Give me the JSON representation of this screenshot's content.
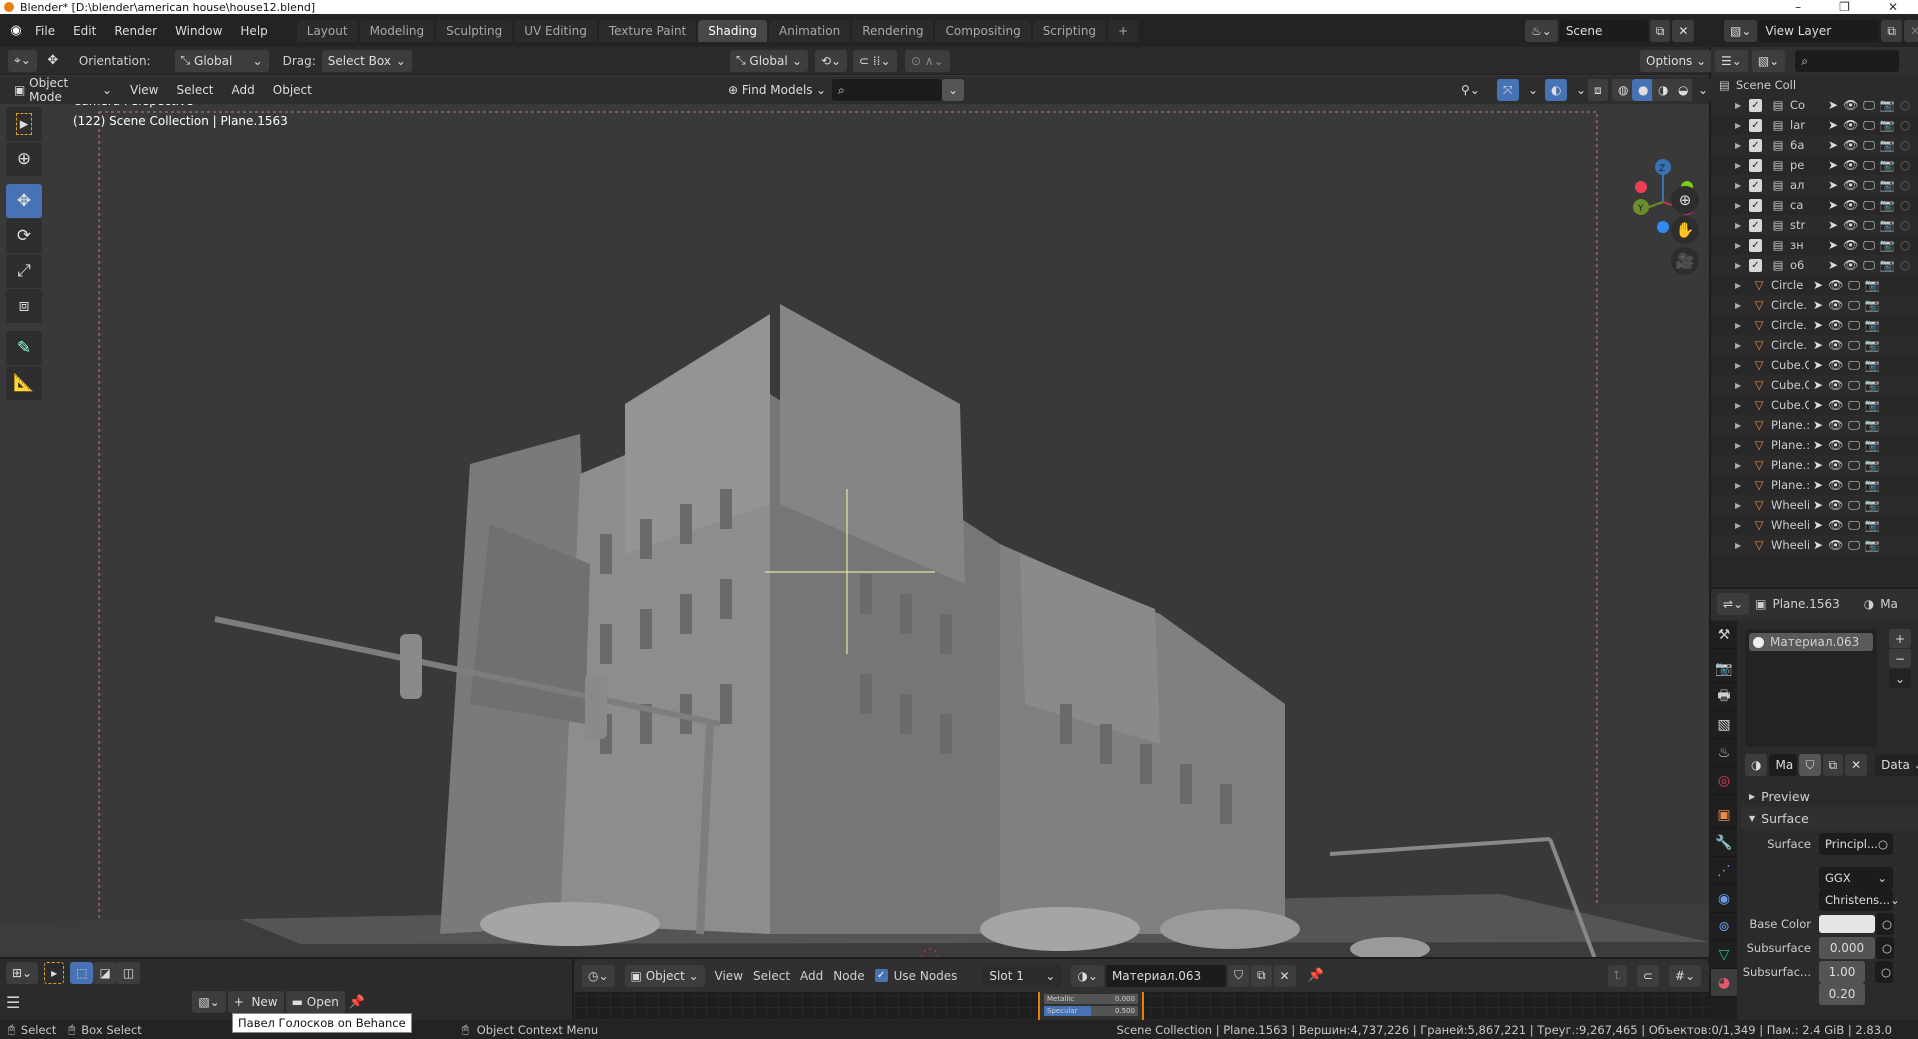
{
  "window": {
    "title": "Blender* [D:\\blender\\american house\\house12.blend]",
    "controls": [
      "–",
      "❐",
      "✕"
    ]
  },
  "menu": [
    "File",
    "Edit",
    "Render",
    "Window",
    "Help"
  ],
  "workspaces": [
    {
      "label": "Layout",
      "active": false
    },
    {
      "label": "Modeling",
      "active": false
    },
    {
      "label": "Sculpting",
      "active": false
    },
    {
      "label": "UV Editing",
      "active": false
    },
    {
      "label": "Texture Paint",
      "active": false
    },
    {
      "label": "Shading",
      "active": true
    },
    {
      "label": "Animation",
      "active": false
    },
    {
      "label": "Rendering",
      "active": false
    },
    {
      "label": "Compositing",
      "active": false
    },
    {
      "label": "Scripting",
      "active": false
    }
  ],
  "scene": {
    "name": "Scene",
    "view_layer": "View Layer"
  },
  "tool_header": {
    "orientation_label": "Orientation:",
    "orientation_value": "Global",
    "drag_label": "Drag:",
    "drag_value": "Select Box",
    "transform_orientation": "Global",
    "options_label": "Options"
  },
  "mode_header": {
    "mode": "Object Mode",
    "menus": [
      "View",
      "Select",
      "Add",
      "Object"
    ],
    "find_models": "Find Models",
    "search_placeholder": ""
  },
  "viewport": {
    "overlay_title": "Camera Perspective",
    "overlay_subtitle": "(122) Scene Collection | Plane.1563",
    "gizmo_axes": {
      "x": "X",
      "y": "Y",
      "z": "Z"
    },
    "colors": {
      "x": "#b33a4c",
      "y": "#6d8c2a",
      "z": "#3672b5",
      "accent": "#4772b3"
    }
  },
  "toolbar": [
    "select-box",
    "cursor",
    "move",
    "rotate",
    "scale",
    "transform",
    "annotate",
    "measure"
  ],
  "outliner": {
    "root": "Scene Coll",
    "collections": [
      "Co",
      "lar",
      "6a",
      "pe",
      "ал",
      "ca",
      "str",
      "зн",
      "o6"
    ],
    "objects": [
      "Circle",
      "Circle.",
      "Circle.",
      "Circle.",
      "Cube.C",
      "Cube.C",
      "Cube.C",
      "Plane.:",
      "Plane.:",
      "Plane.:",
      "Plane.:",
      "Wheeli",
      "Wheeli",
      "Wheeli"
    ]
  },
  "properties": {
    "object": "Plane.1563",
    "tab_label": "Ma",
    "material_slot": "Материал.063",
    "material_short": "Ma",
    "link": "Data",
    "panels": {
      "preview": "Preview",
      "surface": "Surface"
    },
    "surface_label": "Surface",
    "surface_value": "Principl...",
    "distribution": "GGX",
    "subsurface_method": "Christens...",
    "base_color_label": "Base Color",
    "base_color": "#e6e6e6",
    "subsurface_label": "Subsurface",
    "subsurface_value": "0.000",
    "subsurface_radius_label": "Subsurfac...",
    "subsurface_radius": [
      "1.00",
      "0.20"
    ]
  },
  "image_editor": {
    "new_label": "New",
    "open_label": "Open"
  },
  "node_editor": {
    "type": "Object",
    "menus": [
      "View",
      "Select",
      "Add",
      "Node"
    ],
    "use_nodes_label": "Use Nodes",
    "use_nodes": true,
    "slot": "Slot 1",
    "material": "Материал.063",
    "node_fields": [
      {
        "label": "Metallic",
        "value": "0.000"
      },
      {
        "label": "Specular",
        "value": "0.500"
      }
    ]
  },
  "tooltip": "Павел Голосков on Behance",
  "statusbar": {
    "select": "Select",
    "box_select": "Box Select",
    "context_menu": "Object Context Menu",
    "stats": "Scene Collection | Plane.1563 | Вершин:4,737,226 | Граней:5,867,221 | Треуг.:9,267,465 | Объектов:0/1,349 | Пам.: 2.4 GiB | 2.83.0"
  }
}
